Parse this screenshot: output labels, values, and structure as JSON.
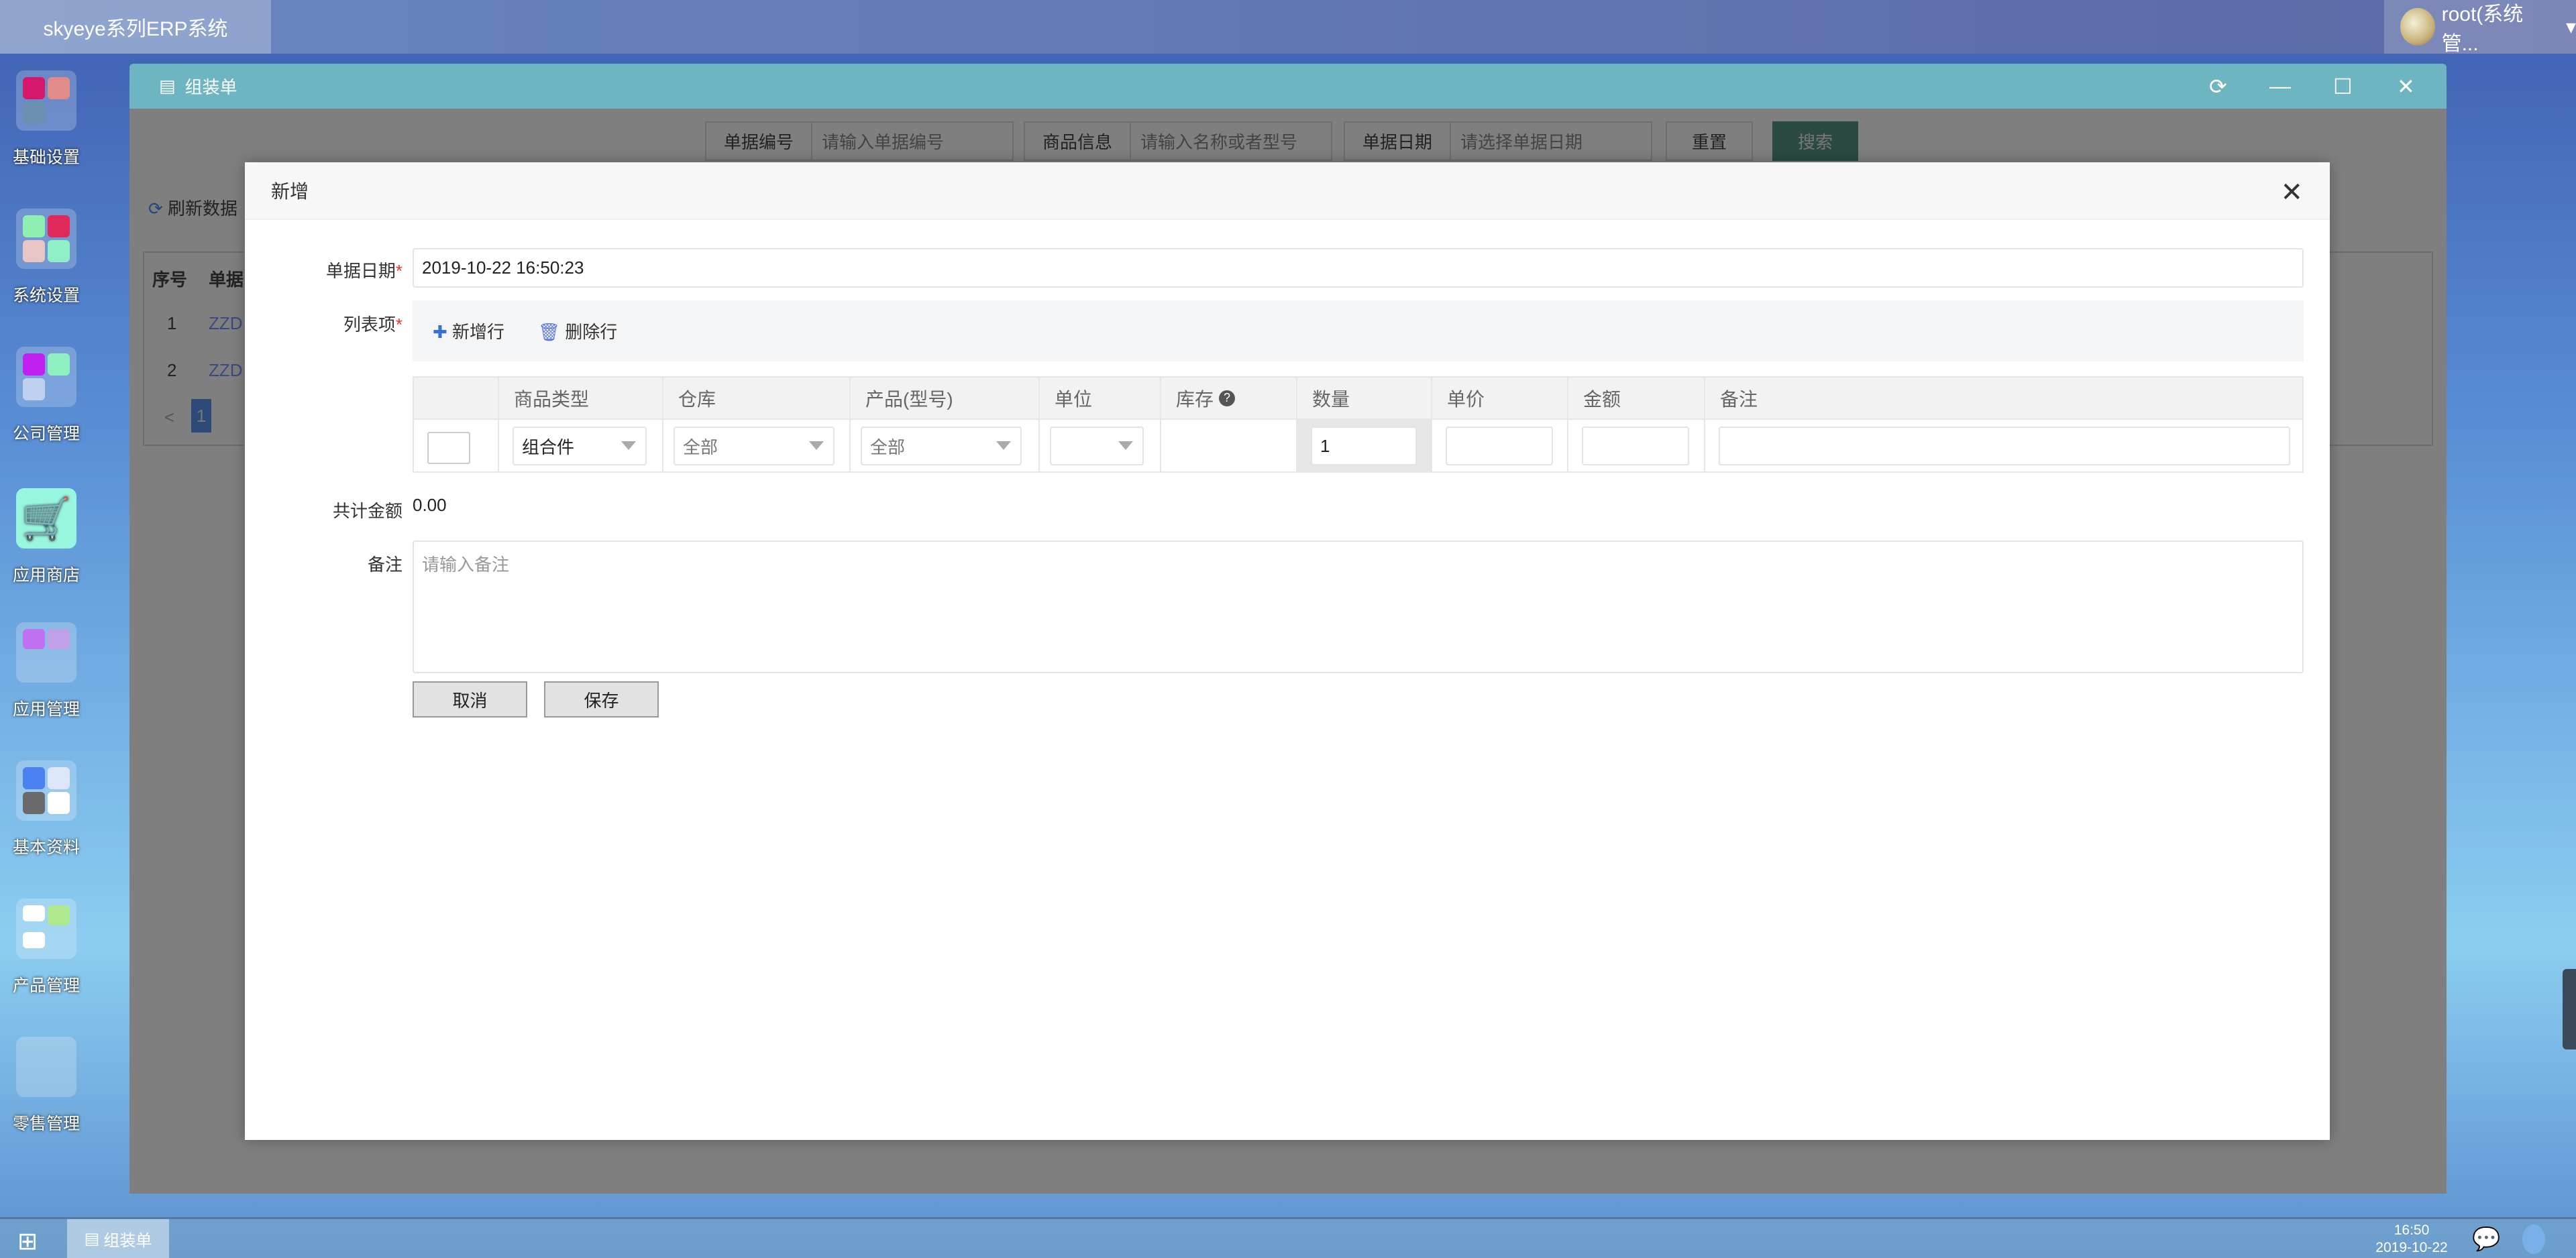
{
  "app": {
    "title": "skyeye系列ERP系统",
    "user": "root(系统管...",
    "user_caret": "▾"
  },
  "sidebar": [
    {
      "label": "基础设置"
    },
    {
      "label": "系统设置"
    },
    {
      "label": "公司管理"
    },
    {
      "label": "应用商店"
    },
    {
      "label": "应用管理"
    },
    {
      "label": "基本资料"
    },
    {
      "label": "产品管理"
    },
    {
      "label": "零售管理"
    }
  ],
  "window": {
    "title": "组装单",
    "refresh": "⟳",
    "minimize": "—",
    "maximize": "☐",
    "close": "✕"
  },
  "search": {
    "fields": [
      {
        "label": "单据编号",
        "placeholder": "请输入单据编号"
      },
      {
        "label": "商品信息",
        "placeholder": "请输入名称或者型号"
      },
      {
        "label": "单据日期",
        "placeholder": "请选择单据日期"
      }
    ],
    "reset": "重置",
    "search": "搜索"
  },
  "background_table": {
    "refresh": "刷新数据",
    "headers": [
      "序号",
      "单据"
    ],
    "rows": [
      [
        "1",
        "ZZD"
      ],
      [
        "2",
        "ZZD"
      ]
    ],
    "page": "1",
    "prev": "<"
  },
  "dialog": {
    "title": "新增",
    "close": "✕",
    "date_label": "单据日期",
    "date_value": "2019-10-22 16:50:23",
    "req": "*",
    "items_label": "列表项",
    "add_row": "新增行",
    "delete_row": "删除行",
    "columns": [
      "",
      "商品类型",
      "仓库",
      "产品(型号)",
      "单位",
      "库存",
      "数量",
      "单价",
      "金额",
      "备注"
    ],
    "row": {
      "type": "组合件",
      "warehouse": "全部",
      "product": "全部",
      "unit": "",
      "stock": "",
      "quantity": "1",
      "price": "",
      "amount": "",
      "remark": ""
    },
    "total_label": "共计金额",
    "total_value": "0.00",
    "remark_label": "备注",
    "remark_placeholder": "请输入备注",
    "cancel": "取消",
    "save": "保存"
  },
  "taskbar": {
    "task": "组装单",
    "time": "16:50",
    "date": "2019-10-22"
  }
}
